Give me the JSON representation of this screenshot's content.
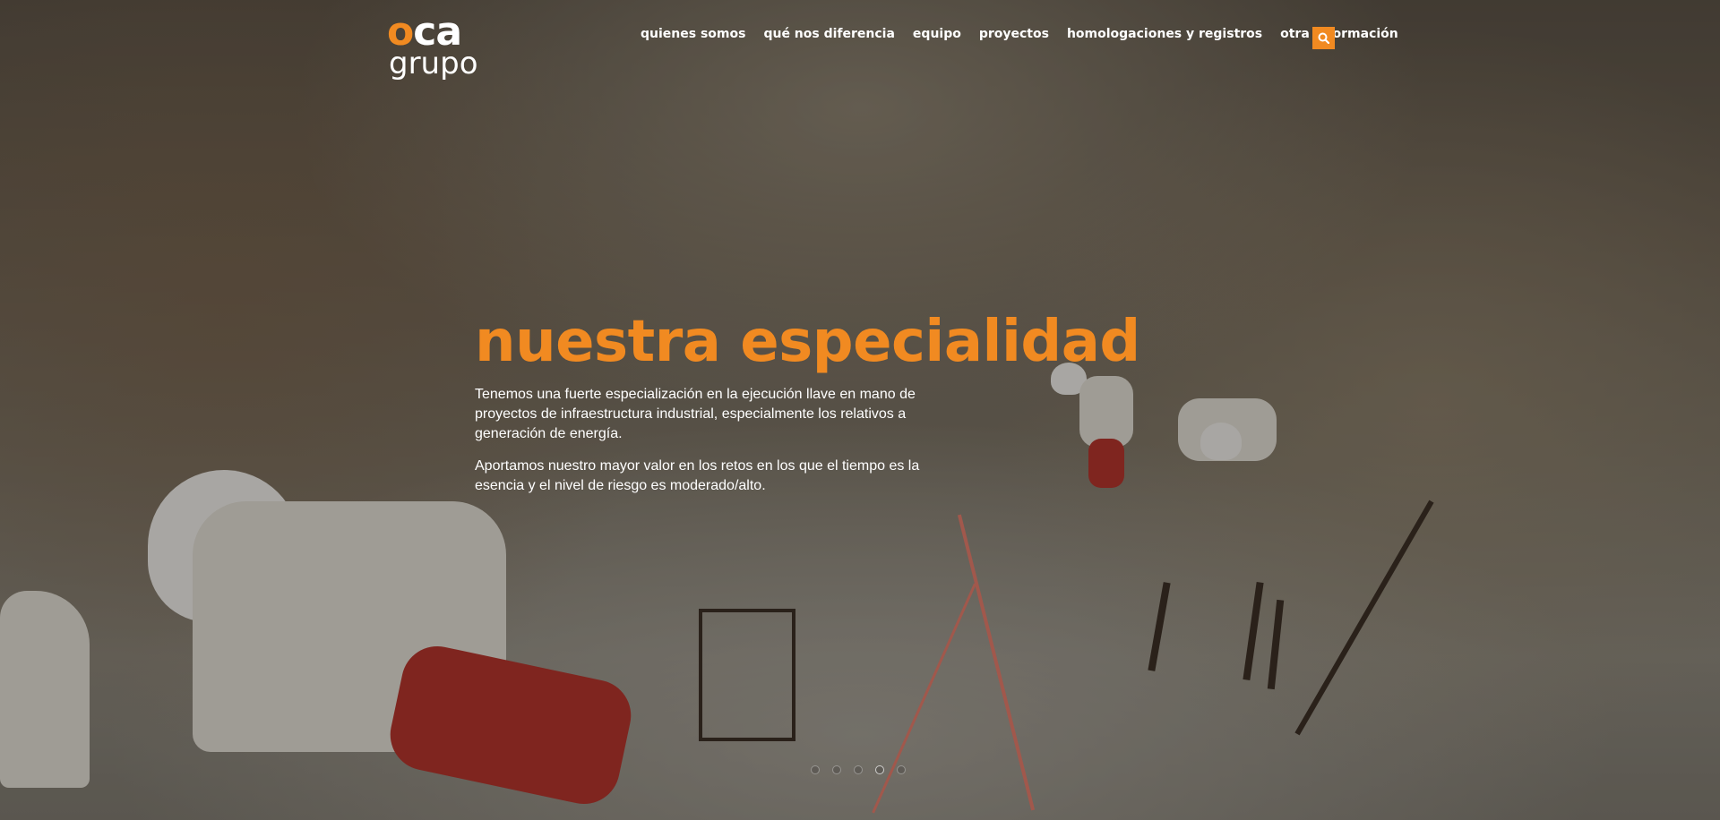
{
  "logo": {
    "top_accent": "o",
    "top_text": "ca",
    "bottom_text": "grupo"
  },
  "nav": {
    "items": [
      {
        "label": "quienes somos"
      },
      {
        "label": "qué nos diferencia"
      },
      {
        "label": "equipo"
      },
      {
        "label": "proyectos"
      },
      {
        "label": "homologaciones y registros"
      },
      {
        "label": "otra información"
      }
    ],
    "search_icon": "search-icon"
  },
  "hero": {
    "headline": "nuestra especialidad",
    "paragraphs": [
      "Tenemos una fuerte especialización en la ejecución llave en mano de proyectos de infraestructura industrial, especialmente los relativos a generación de energía.",
      "Aportamos nuestro mayor valor en los retos en los que el tiempo es la esencia y el nivel de riesgo es moderado/alto."
    ]
  },
  "slider": {
    "dot_count": 5,
    "active_index": 4
  },
  "colors": {
    "accent": "#f18a21",
    "text": "#ffffff"
  }
}
